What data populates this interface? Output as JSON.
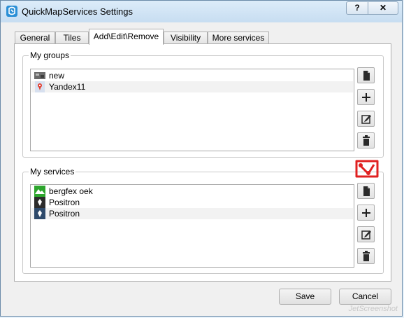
{
  "window": {
    "title": "QuickMapServices Settings",
    "help_label": "?",
    "close_label": "✕"
  },
  "tabs": [
    {
      "label": "General"
    },
    {
      "label": "Tiles"
    },
    {
      "label": "Add\\Edit\\Remove"
    },
    {
      "label": "Visibility"
    },
    {
      "label": "More services"
    }
  ],
  "active_tab": "Add\\Edit\\Remove",
  "groups": {
    "label": "My groups",
    "items": [
      {
        "label": "new",
        "icon": "map-thumbnail-icon"
      },
      {
        "label": "Yandex11",
        "icon": "yandex-pin-icon"
      }
    ]
  },
  "services": {
    "label": "My services",
    "items": [
      {
        "label": "bergfex oek",
        "icon": "bergfex-icon"
      },
      {
        "label": "Positron",
        "icon": "carto-icon"
      },
      {
        "label": "Positron",
        "icon": "carto-icon"
      }
    ]
  },
  "side_buttons": [
    "copy-icon",
    "add-icon",
    "edit-icon",
    "delete-icon"
  ],
  "footer": {
    "save_label": "Save",
    "cancel_label": "Cancel"
  },
  "watermark": "JetScreenshot",
  "colors": {
    "accent_red": "#e02020",
    "selected_row": "#f2f2f2"
  }
}
